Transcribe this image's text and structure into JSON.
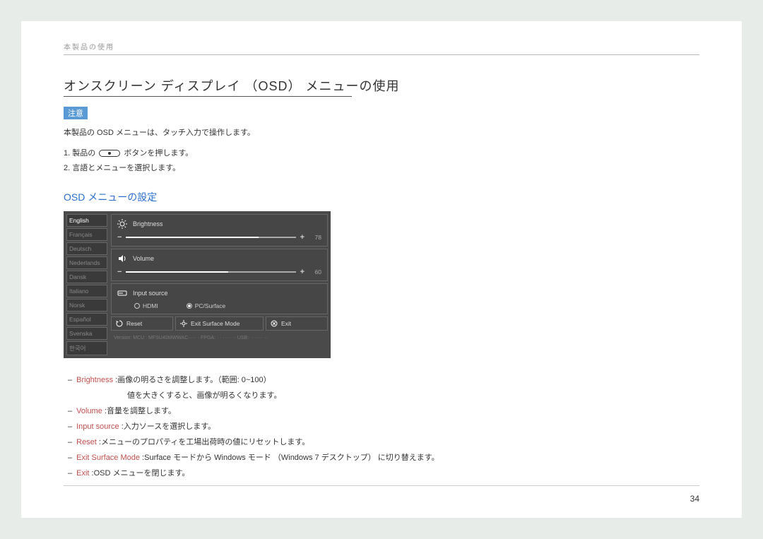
{
  "breadcrumb": "本製品の使用",
  "title": "オンスクリーン ディスプレイ （OSD） メニューの使用",
  "notice_label": "注意",
  "intro": "本製品の OSD メニューは、タッチ入力で操作します。",
  "steps": {
    "s1a": "1.  製品の ",
    "s1b": " ボタンを押します。",
    "s2": "2.  言語とメニューを選択します。"
  },
  "subheading": "OSD メニューの設定",
  "osd": {
    "languages": [
      "English",
      "Français",
      "Deutsch",
      "Nederlands",
      "Dansk",
      "Italiano",
      "Norsk",
      "Español",
      "Svenska",
      "한국어"
    ],
    "active_lang_index": 0,
    "brightness": {
      "label": "Brightness",
      "value": "78",
      "fill": 78
    },
    "volume": {
      "label": "Volume",
      "value": "60",
      "fill": 60
    },
    "input_source": {
      "label": "Input source",
      "opt1": "HDMI",
      "opt2": "PC/Surface",
      "selected": 1
    },
    "buttons": {
      "reset": "Reset",
      "exit_surface": "Exit Surface Mode",
      "exit": "Exit"
    },
    "version": "Version:   MCU : MFSU40MWWAC·····  ·    FPGA: · · ····· ··    USB:· · ····· ··"
  },
  "descriptions": [
    {
      "term": "Brightness",
      "text": " :画像の明るさを調整します。（範囲: 0~100）",
      "cont": "値を大きくすると、画像が明るくなります。"
    },
    {
      "term": "Volume",
      "text": " :音量を調整します。"
    },
    {
      "term": "Input source",
      "text": " :入力ソースを選択します。"
    },
    {
      "term": "Reset",
      "text": " :メニューのプロパティを工場出荷時の値にリセットします。"
    },
    {
      "term": "Exit Surface Mode",
      "text": " :Surface モードから Windows モード （Windows 7 デスクトップ） に切り替えます。"
    },
    {
      "term": "Exit",
      "text": " :OSD メニューを閉じます。"
    }
  ],
  "page_number": "34"
}
